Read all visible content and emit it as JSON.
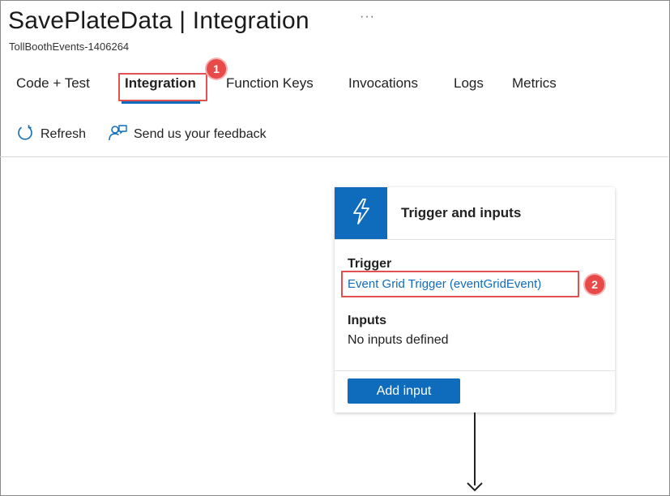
{
  "header": {
    "title": "SavePlateData | Integration",
    "more": "···",
    "subtitle": "TollBoothEvents-1406264"
  },
  "tabs": [
    {
      "label": "Code + Test"
    },
    {
      "label": "Integration",
      "active": true
    },
    {
      "label": "Function Keys"
    },
    {
      "label": "Invocations"
    },
    {
      "label": "Logs"
    },
    {
      "label": "Metrics"
    }
  ],
  "toolbar": {
    "refresh_label": "Refresh",
    "feedback_label": "Send us your feedback"
  },
  "card": {
    "title": "Trigger and inputs",
    "trigger_heading": "Trigger",
    "trigger_link": "Event Grid Trigger (eventGridEvent)",
    "inputs_heading": "Inputs",
    "inputs_text": "No inputs defined",
    "add_input_label": "Add input"
  },
  "annotations": {
    "step1": "1",
    "step2": "2"
  },
  "icons": {
    "card_icon": "lightning-bolt-icon",
    "refresh": "refresh-icon",
    "feedback": "feedback-icon"
  },
  "colors": {
    "accent": "#0f6cbd",
    "highlight": "#e25050",
    "badge": "#e84a4a"
  }
}
